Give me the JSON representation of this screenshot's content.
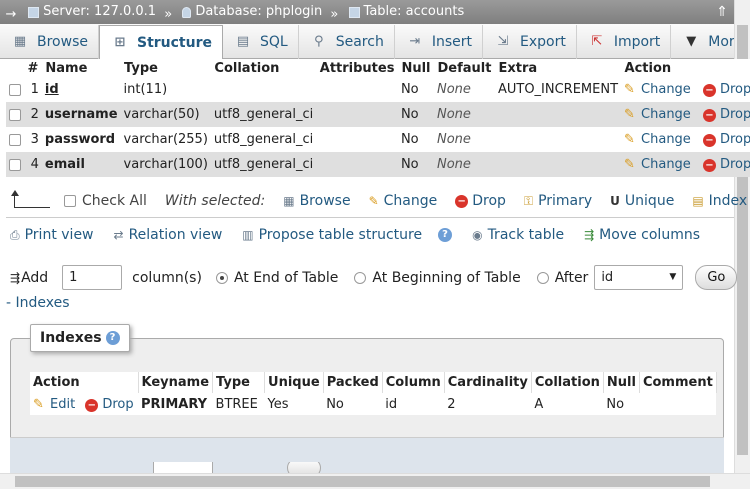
{
  "breadcrumb": {
    "server": "Server: 127.0.0.1",
    "database": "Database: phplogin",
    "table": "Table: accounts",
    "sep": "»"
  },
  "tabs": [
    {
      "label": "Browse",
      "icon": "browse-icon"
    },
    {
      "label": "Structure",
      "icon": "structure-icon",
      "active": true
    },
    {
      "label": "SQL",
      "icon": "sql-icon"
    },
    {
      "label": "Search",
      "icon": "search-icon"
    },
    {
      "label": "Insert",
      "icon": "insert-icon"
    },
    {
      "label": "Export",
      "icon": "export-icon"
    },
    {
      "label": "Import",
      "icon": "import-icon"
    },
    {
      "label": "More",
      "icon": "chevron-down-icon"
    }
  ],
  "columns_table": {
    "headers": [
      "#",
      "Name",
      "Type",
      "Collation",
      "Attributes",
      "Null",
      "Default",
      "Extra",
      "Action"
    ],
    "rows": [
      {
        "num": "1",
        "name": "id",
        "type": "int(11)",
        "collation": "",
        "attributes": "",
        "null": "No",
        "default": "None",
        "extra": "AUTO_INCREMENT"
      },
      {
        "num": "2",
        "name": "username",
        "type": "varchar(50)",
        "collation": "utf8_general_ci",
        "attributes": "",
        "null": "No",
        "default": "None",
        "extra": ""
      },
      {
        "num": "3",
        "name": "password",
        "type": "varchar(255)",
        "collation": "utf8_general_ci",
        "attributes": "",
        "null": "No",
        "default": "None",
        "extra": ""
      },
      {
        "num": "4",
        "name": "email",
        "type": "varchar(100)",
        "collation": "utf8_general_ci",
        "attributes": "",
        "null": "No",
        "default": "None",
        "extra": ""
      }
    ],
    "action_change": "Change",
    "action_drop": "Drop"
  },
  "bulk": {
    "check_all": "Check All",
    "with_selected": "With selected:",
    "actions": [
      "Browse",
      "Change",
      "Drop",
      "Primary",
      "Unique",
      "Index"
    ]
  },
  "tools": [
    "Print view",
    "Relation view",
    "Propose table structure",
    "Track table",
    "Move columns"
  ],
  "add_column": {
    "label": "Add",
    "count": "1",
    "unit": "column(s)",
    "opt_end": "At End of Table",
    "opt_begin": "At Beginning of Table",
    "opt_after": "After",
    "after_value": "id",
    "go": "Go"
  },
  "indexes_link": "- Indexes",
  "indexes": {
    "legend": "Indexes",
    "headers": [
      "Action",
      "Keyname",
      "Type",
      "Unique",
      "Packed",
      "Column",
      "Cardinality",
      "Collation",
      "Null",
      "Comment"
    ],
    "row": {
      "edit": "Edit",
      "drop": "Drop",
      "keyname": "PRIMARY",
      "type": "BTREE",
      "unique": "Yes",
      "packed": "No",
      "column": "id",
      "cardinality": "2",
      "collation": "A",
      "null": "No",
      "comment": ""
    }
  },
  "colors": {
    "link": "#235a81",
    "breadcrumb_bg": "#8e8e8e",
    "row_alt": "#dfdfdf"
  }
}
